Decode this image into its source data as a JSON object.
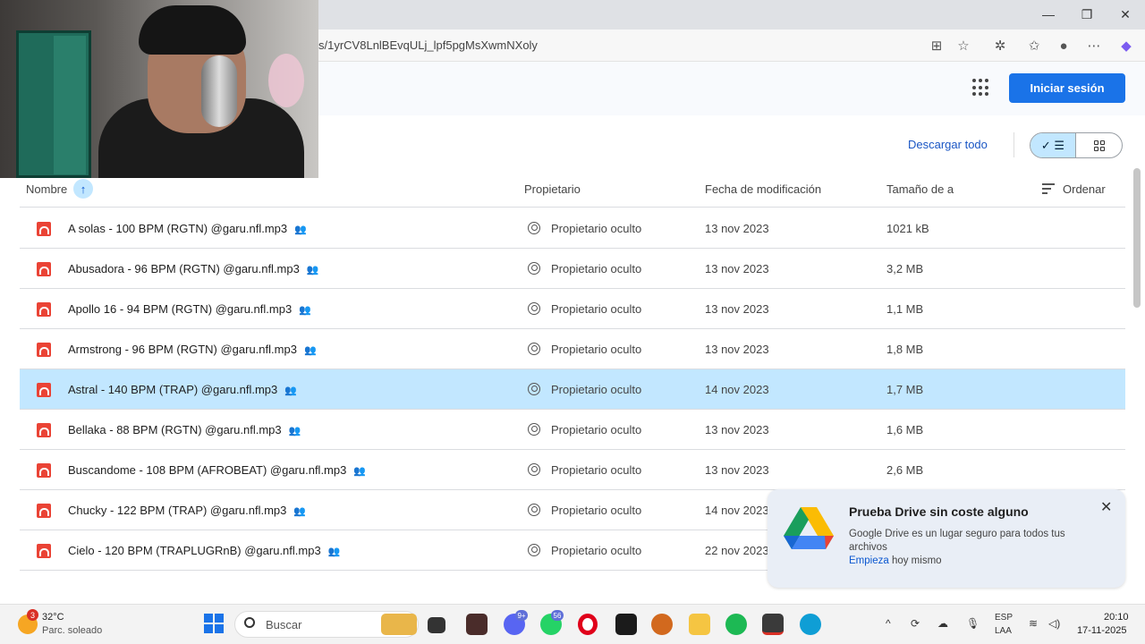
{
  "browser": {
    "url": "s/1yrCV8LnlBEvqULj_lpf5pgMsXwmNXoly"
  },
  "header": {
    "signin_label": "Iniciar sesión"
  },
  "toolbar": {
    "download_all": "Descargar todo",
    "view_mode": "list"
  },
  "table": {
    "columns": [
      "Nombre",
      "Propietario",
      "Fecha de modificación",
      "Tamaño de a",
      "Ordenar"
    ],
    "rows": [
      {
        "name": "A solas - 100 BPM (RGTN) @garu.nfl.mp3",
        "owner": "Propietario oculto",
        "date": "13 nov 2023",
        "size": "1021 kB"
      },
      {
        "name": "Abusadora - 96 BPM (RGTN) @garu.nfl.mp3",
        "owner": "Propietario oculto",
        "date": "13 nov 2023",
        "size": "3,2 MB"
      },
      {
        "name": "Apollo 16 - 94 BPM (RGTN) @garu.nfl.mp3",
        "owner": "Propietario oculto",
        "date": "13 nov 2023",
        "size": "1,1 MB"
      },
      {
        "name": "Armstrong - 96 BPM (RGTN) @garu.nfl.mp3",
        "owner": "Propietario oculto",
        "date": "13 nov 2023",
        "size": "1,8 MB"
      },
      {
        "name": "Astral - 140 BPM (TRAP) @garu.nfl.mp3",
        "owner": "Propietario oculto",
        "date": "14 nov 2023",
        "size": "1,7 MB"
      },
      {
        "name": "Bellaka - 88 BPM (RGTN) @garu.nfl.mp3",
        "owner": "Propietario oculto",
        "date": "13 nov 2023",
        "size": "1,6 MB"
      },
      {
        "name": "Buscandome - 108 BPM (AFROBEAT) @garu.nfl.mp3",
        "owner": "Propietario oculto",
        "date": "13 nov 2023",
        "size": "2,6 MB"
      },
      {
        "name": "Chucky - 122 BPM (TRAP) @garu.nfl.mp3",
        "owner": "Propietario oculto",
        "date": "14 nov 2023",
        "size": ""
      },
      {
        "name": "Cielo - 120 BPM (TRAPLUGRnB) @garu.nfl.mp3",
        "owner": "Propietario oculto",
        "date": "22 nov 2023",
        "size": ""
      }
    ]
  },
  "promo": {
    "title": "Prueba Drive sin coste alguno",
    "text": "Google Drive es un lugar seguro para todos tus archivos",
    "cta_link": "Empieza",
    "cta_rest": " hoy mismo"
  },
  "taskbar": {
    "weather_temp": "32°C",
    "weather_desc": "Parc. soleado",
    "weather_badge": "3",
    "search_label": "Buscar",
    "badge_discord": "9+",
    "badge_whatsapp": "56",
    "lang_top": "ESP",
    "lang_bottom": "LAA",
    "time": "20:10",
    "date": "17-11-2025"
  },
  "colors": {
    "accent": "#1a73e8",
    "selected_row": "#c2e7ff",
    "file_icon": "#ea4335"
  }
}
